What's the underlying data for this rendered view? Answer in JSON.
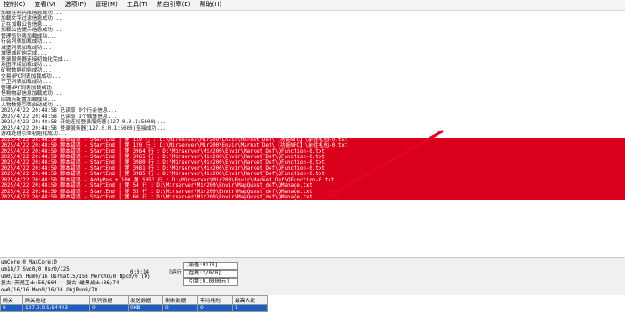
{
  "menu": [
    "控制(C)",
    "查看(V)",
    "选项(P)",
    "管理(M)",
    "工具(T)",
    "热自引擎(E)",
    "帮助(H)"
  ],
  "log": {
    "lines": [
      "加载任务药降信息成功...",
      "加载文字过滤信息成功...",
      "正在加载公告信息...",
      "加载公告提示信息成功...",
      "管理员列表加载成功...",
      "行会列表加载成功...",
      "城堡列表加载成功...",
      "城堡城初始完成...",
      "登录服务器连接初始化完成...",
      "地图环境加载成功...",
      "矿物数据初始成功...",
      "交易NPC列表加载成功...",
      "守卫列表加载成功...",
      "管理NPC列表加载成功...",
      "怪物物品信息加载成功...",
      "回城点配置加载成功...",
      "人物数据引擎启动成功...",
      "2025/4/22 20:48:58 已读取 0个行会信息...",
      "2025/4/22 20:48:58 已读取 1个城堡信息...",
      "2025/4/22 20:48:58 开始连接登录服务器(127.0.0.1:5600)...",
      "2025/4/22 20:48:58 登录服务器(127.0.0.1:5600)连接成功...",
      "游戏处理引擎初始化成功..."
    ],
    "errors": [
      "2025/4/22 20:48:59 脚本错误 - StartEnd | 第 119 行 : D:\\Mirserver\\Mir200\\Envir\\Market_Def\\【功能NPC】\\前往礼包-0.txt",
      "2025/4/22 20:48:59 脚本错误 - StartEnd | 第 120 行 : D:\\Mirserver\\Mir200\\Envir\\Market_Def\\【功能NPC】\\前往礼包-0.txt",
      "2025/4/22 20:48:59 脚本错误 - StartEnd | 第 3964 行 : D:\\Mirserver\\Mir200\\Envir\\Market_Def\\QFunction-0.txt",
      "2025/4/22 20:48:59 脚本错误 - StartEnd | 第 3965 行 : D:\\Mirserver\\Mir200\\Envir\\Market_Def\\QFunction-0.txt",
      "2025/4/22 20:48:59 脚本错误 - StartEnd | 第 3980 行 : D:\\Mirserver\\Mir200\\Envir\\Market_Def\\QFunction-0.txt",
      "2025/4/22 20:48:59 脚本错误 - StartEnd | 第 3981 行 : D:\\Mirserver\\Mir200\\Envir\\Market_Def\\QFunction-0.txt",
      "2025/4/22 20:48:59 脚本错误 - StartEnd | 第 3985 行 : D:\\Mirserver\\Mir200\\Envir\\Market_Def\\QFunction-0.txt",
      "2025/4/22 20:48:59 脚本错误 - AddyPos + 100 第 5053 行 : D:\\Mirserver\\Mir200\\Envir\\Market_Def\\QFunction-0.txt",
      "2025/4/22 20:48:59 脚本错误 - StartEnd | 第 54 行 : D:\\Mirserver\\Mir200\\Envir\\MapQuest_def\\QManage.txt",
      "2025/4/22 20:48:59 脚本错误 - StartEnd | 第 55 行 : D:\\Mirserver\\Mir200\\Envir\\MapQuest_def\\QManage.txt",
      "2025/4/22 20:48:59 脚本错误 - StartEnd | 第 60 行 : D:\\Mirserver\\Mir200\\Envir\\MapQuest_def\\QManage.txt"
    ]
  },
  "status": {
    "line1": "umCore:0 MaxCore:0",
    "line2": "um18/7 Svc0/0 Usr0/125",
    "line3": "um0/125 Hum0/16 UsrRat15/156 MerchO/0 Npc0/0 (0)",
    "line4": "复古·天赐卫士:56/664 · 复古·雌黑战士:36/74",
    "line5": "ow0/16/16 Mon0/16/16 ObjRun0/78",
    "time": "0:0:14",
    "run_label": "[运行]",
    "box1": "[吸怪:9173]",
    "box2": "[在线:2/0/0]",
    "box3": "[引擎:0.0000元]"
  },
  "grid": {
    "headers": [
      "网关",
      "网关地址",
      "队列数据",
      "发送数据",
      "剩余数据",
      "平均耗时",
      "最高人数"
    ],
    "row": [
      "0",
      "127.0.0.1:54443",
      "0",
      "0KB",
      "0",
      "0",
      "1"
    ]
  }
}
